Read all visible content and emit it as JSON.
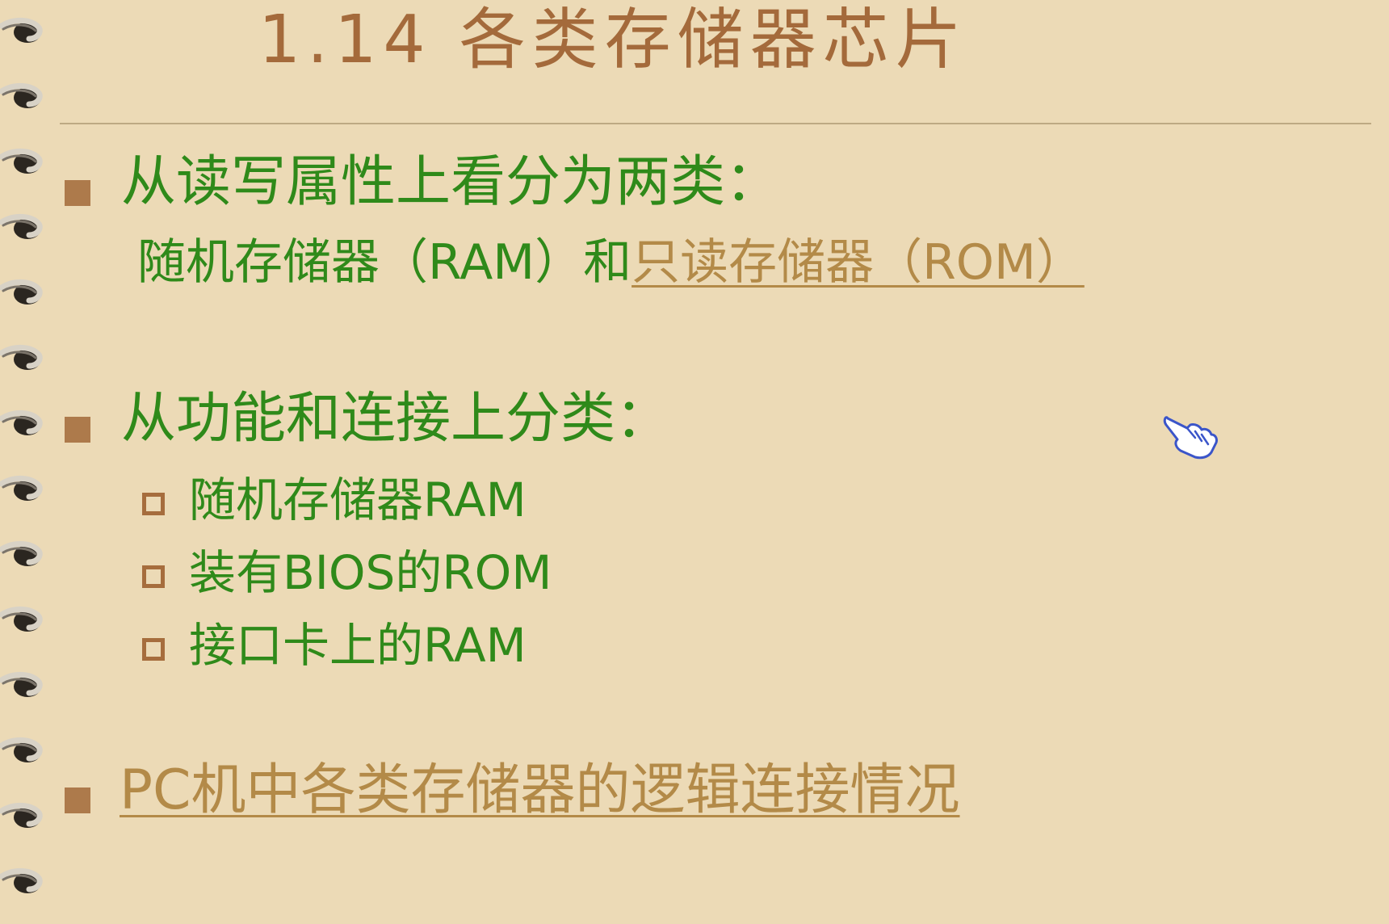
{
  "slide": {
    "title": "1.14 各类存储器芯片",
    "section1": {
      "heading": "从读写属性上看分为两类：",
      "line2_prefix": "随机存储器（RAM）和",
      "line2_link": "只读存储器（ROM）"
    },
    "section2": {
      "heading": "从功能和连接上分类：",
      "items": [
        "随机存储器RAM",
        "装有BIOS的ROM",
        "接口卡上的RAM"
      ]
    },
    "section3": {
      "link": "PC机中各类存储器的逻辑连接情况"
    }
  },
  "cursor": {
    "icon": "hand-pointer-icon"
  },
  "colors": {
    "background": "#ecdab6",
    "title": "#a46a3b",
    "body_text": "#2f8a1a",
    "link_text": "#b38a48",
    "bullet": "#ad7a4b"
  }
}
